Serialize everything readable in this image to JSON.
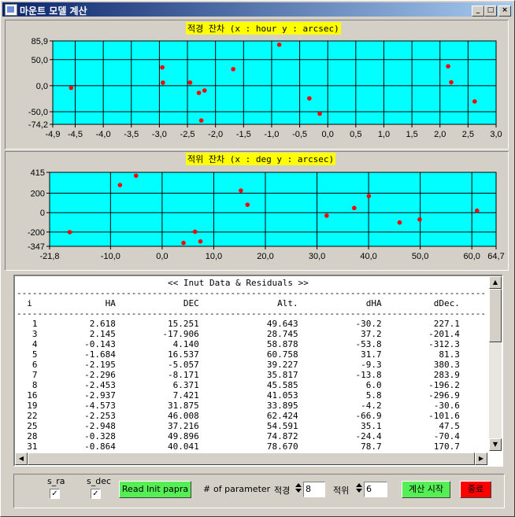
{
  "window": {
    "title": "마운트 모델 계산"
  },
  "colors": {
    "plot_bg": "#00ffff",
    "point": "#ff0000",
    "title_bg": "#ffff00",
    "green_btn": "#55ee55",
    "red_btn": "#ff0000"
  },
  "chart_data": [
    {
      "type": "scatter",
      "title": "적경 잔차 (x : hour  y : arcsec)",
      "xlim": [
        -4.9,
        3.0
      ],
      "ylim": [
        -74.2,
        85.9
      ],
      "xticks": [
        "-4,9",
        "-4,5",
        "-4,0",
        "-3,5",
        "-3,0",
        "-2,5",
        "-2,0",
        "-1,5",
        "-1,0",
        "-0,5",
        "0,0",
        "0,5",
        "1,0",
        "1,5",
        "2,0",
        "2,5",
        "3,0"
      ],
      "yticks": [
        "85,9",
        "50,0",
        "0,0",
        "-50,0",
        "-74,2"
      ],
      "grid": true,
      "points": [
        {
          "x": 2.618,
          "y": -30.2
        },
        {
          "x": 2.145,
          "y": 37.2
        },
        {
          "x": -0.143,
          "y": -53.8
        },
        {
          "x": -1.684,
          "y": 31.7
        },
        {
          "x": -2.195,
          "y": -9.3
        },
        {
          "x": -2.296,
          "y": -13.8
        },
        {
          "x": -2.453,
          "y": 6.0
        },
        {
          "x": -2.937,
          "y": 5.8
        },
        {
          "x": -4.573,
          "y": -4.2
        },
        {
          "x": -2.253,
          "y": -66.9
        },
        {
          "x": -2.948,
          "y": 35.1
        },
        {
          "x": -0.328,
          "y": -24.4
        },
        {
          "x": -0.864,
          "y": 78.7
        },
        {
          "x": 2.2,
          "y": 6.5
        }
      ]
    },
    {
      "type": "scatter",
      "title": "적위 잔차 (x : deg  y : arcsec)",
      "xlim": [
        -21.8,
        64.7
      ],
      "ylim": [
        -347,
        415
      ],
      "xticks": [
        "-21,8",
        "-10,0",
        "0,0",
        "10,0",
        "20,0",
        "30,0",
        "40,0",
        "50,0",
        "60,0",
        "64,7"
      ],
      "yticks": [
        "415",
        "200",
        "0",
        "-200",
        "-347"
      ],
      "grid": true,
      "points": [
        {
          "x": -17.906,
          "y": -201.4
        },
        {
          "x": -8.171,
          "y": 283.9
        },
        {
          "x": -5.057,
          "y": 380.3
        },
        {
          "x": 4.14,
          "y": -312.3
        },
        {
          "x": 6.371,
          "y": -196.2
        },
        {
          "x": 7.421,
          "y": -296.9
        },
        {
          "x": 15.251,
          "y": 227.1
        },
        {
          "x": 16.537,
          "y": 81.3
        },
        {
          "x": 31.875,
          "y": -30.6
        },
        {
          "x": 37.216,
          "y": 47.5
        },
        {
          "x": 40.041,
          "y": 170.7
        },
        {
          "x": 46.008,
          "y": -101.6
        },
        {
          "x": 49.896,
          "y": -70.4
        },
        {
          "x": 61.0,
          "y": 20.0
        }
      ]
    }
  ],
  "residuals": {
    "header": "<< Inut Data & Residuals >>",
    "columns": [
      "i",
      "HA",
      "DEC",
      "Alt.",
      "dHA",
      "dDec."
    ],
    "rows": [
      [
        "1",
        "2.618",
        "15.251",
        "49.643",
        "-30.2",
        "227.1"
      ],
      [
        "3",
        "2.145",
        "-17.906",
        "28.745",
        "37.2",
        "-201.4"
      ],
      [
        "4",
        "-0.143",
        "4.140",
        "58.878",
        "-53.8",
        "-312.3"
      ],
      [
        "5",
        "-1.684",
        "16.537",
        "60.758",
        "31.7",
        "81.3"
      ],
      [
        "6",
        "-2.195",
        "-5.057",
        "39.227",
        "-9.3",
        "380.3"
      ],
      [
        "7",
        "-2.296",
        "-8.171",
        "35.817",
        "-13.8",
        "283.9"
      ],
      [
        "8",
        "-2.453",
        "6.371",
        "45.585",
        "6.0",
        "-196.2"
      ],
      [
        "16",
        "-2.937",
        "7.421",
        "41.053",
        "5.8",
        "-296.9"
      ],
      [
        "19",
        "-4.573",
        "31.875",
        "33.895",
        "-4.2",
        "-30.6"
      ],
      [
        "22",
        "-2.253",
        "46.008",
        "62.424",
        "-66.9",
        "-101.6"
      ],
      [
        "25",
        "-2.948",
        "37.216",
        "54.591",
        "35.1",
        "47.5"
      ],
      [
        "28",
        "-0.328",
        "49.896",
        "74.872",
        "-24.4",
        "-70.4"
      ],
      [
        "31",
        "-0.864",
        "40.041",
        "78.670",
        "78.7",
        "170.7"
      ]
    ]
  },
  "controls": {
    "s_ra_label": "s_ra",
    "s_dec_label": "s_dec",
    "s_ra_checked": true,
    "s_dec_checked": true,
    "read_button": "Read Init papra",
    "hash": "#",
    "param_label": "of parameter",
    "ra_label": "적경",
    "ra_value": "8",
    "dec_label": "적위",
    "dec_value": "6",
    "start_button": "계산 시작",
    "exit_button": "종료"
  }
}
